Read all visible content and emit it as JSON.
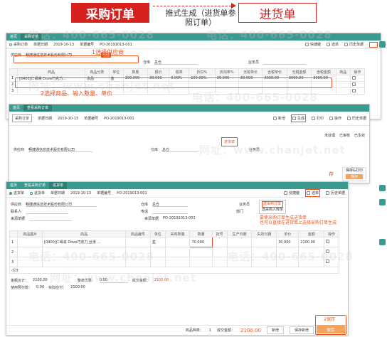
{
  "header": {
    "left_title": "采购订单",
    "right_title": "进货单",
    "arrow_text": "推式生成（进货单参照订单）"
  },
  "watermark": {
    "phone": "电话：400-665-0028",
    "site": "网址：www.chanjet.net"
  },
  "win1": {
    "tab1": "首页",
    "tab2": "采购订单",
    "tabs": [
      "采购订单"
    ],
    "date_label": "单据日期",
    "date": "2019-10-13",
    "no_label": "单据编号",
    "no": "PO-20191013-001",
    "toolbar": [
      "快捷键",
      "选单",
      "历史单据"
    ],
    "supplier_label": "供应商",
    "supplier": "畅捷通信息技术股份有限公司",
    "supplier_tag": "现结",
    "step1": "1选择供应商",
    "warehouse_label": "仓库",
    "warehouse": "总仓",
    "staff_label": "业务员",
    "headers": [
      "",
      "商品",
      "商品分类",
      "单位",
      "数量",
      "报价",
      "税率",
      "折扣%",
      "折扣率%",
      "无税单价",
      "含税单价",
      "无税金额",
      "含税金额",
      "",
      "商品",
      "操作"
    ],
    "row": [
      "1",
      "[0400]仁缘来 Dove巧克力...",
      "食品",
      "盒",
      "100.000",
      "30.000",
      "0.00%",
      "100.00%",
      "30.000",
      "30.000",
      "3000.00",
      "3000.00"
    ],
    "step2": "2选择商品、输入数量、单价",
    "rows_extra": [
      "2",
      "3",
      "4",
      "5",
      "6"
    ]
  },
  "win2": {
    "tab1": "首页",
    "tab2": "查看采购订单",
    "title": "采购订单",
    "date_label": "单据日期",
    "date": "2019-10-13",
    "no_label": "单据编号",
    "no": "PO-2019013-001",
    "toolbar": [
      "新增",
      "生成",
      "打印",
      "操作",
      "历史单据"
    ],
    "gen_menu": "进货单",
    "status": [
      "未处理",
      "已审核",
      "已生效"
    ],
    "supplier_label": "供应商",
    "supplier": "畅捷通信息技术股份有限公司",
    "warehouse_label": "仓库",
    "warehouse": "总仓",
    "staff_label": "业务员",
    "side_label": "保存&打印",
    "side_btn": "保存",
    "save_btn": "存",
    "bottom_btn": "新增"
  },
  "win3": {
    "tab1": "首页",
    "tab2": "查看采购订单",
    "tab3": "进货单",
    "radio1": "进货单",
    "radio2": "退货单",
    "date_label": "单据日期",
    "date": "2019-10-13",
    "no_label": "单据编号",
    "no": "PO-2019013-001",
    "toolbar": [
      "快捷键",
      "选单",
      "历史单据"
    ],
    "sel_menu": [
      "选采购订单",
      "选采购入库单"
    ],
    "supplier_label": "供应商",
    "supplier": "畅捷通信息技术股份有限公司",
    "warehouse_label": "仓库",
    "warehouse": "总仓",
    "contact_label": "联系人",
    "phone_label": "电话",
    "staff_label": "业务员",
    "address_label": "地址",
    "dept_label": "部门",
    "src_label": "来源单据",
    "src": "PO-20191013-001",
    "src2_label": "来源单据",
    "src2": "PO-2019013-001",
    "note1": "要使采购订单生成进货单",
    "note2": "也可以直接在进货单上选择采购订单生成",
    "headers": [
      "",
      "商品图片",
      "商品",
      "商品编号",
      "单位",
      "采购数量",
      "数量",
      "批号",
      "生产日期",
      "失效日期",
      "单价",
      "金额",
      "操作"
    ],
    "row": [
      "1",
      "",
      "[0400]仁缘来 Dove巧克力 丝滑 ...",
      "",
      "盒",
      "",
      "70.000",
      "",
      "",
      "",
      "30.000",
      "2100.00"
    ],
    "rows_extra": [
      "2",
      "3"
    ],
    "subtotal": "小计",
    "total_label": "金额合计：",
    "total": "2100.00",
    "discount_label": "整单优惠：",
    "discount": "0.00",
    "deal_label": "成交金额：",
    "deal": "2100.00",
    "prepay_label": "使用预付款：",
    "prepay": "0.00",
    "actual_label": "实际应付：",
    "actual": "2100.00",
    "kinds_label": "商品种类：",
    "kinds": "1",
    "deal2_label": "成交金额：",
    "deal2": "2100.00",
    "btn_add": "新增",
    "btn_save_add": "保存新增",
    "btn_save": "保存",
    "step3": "2保存"
  }
}
